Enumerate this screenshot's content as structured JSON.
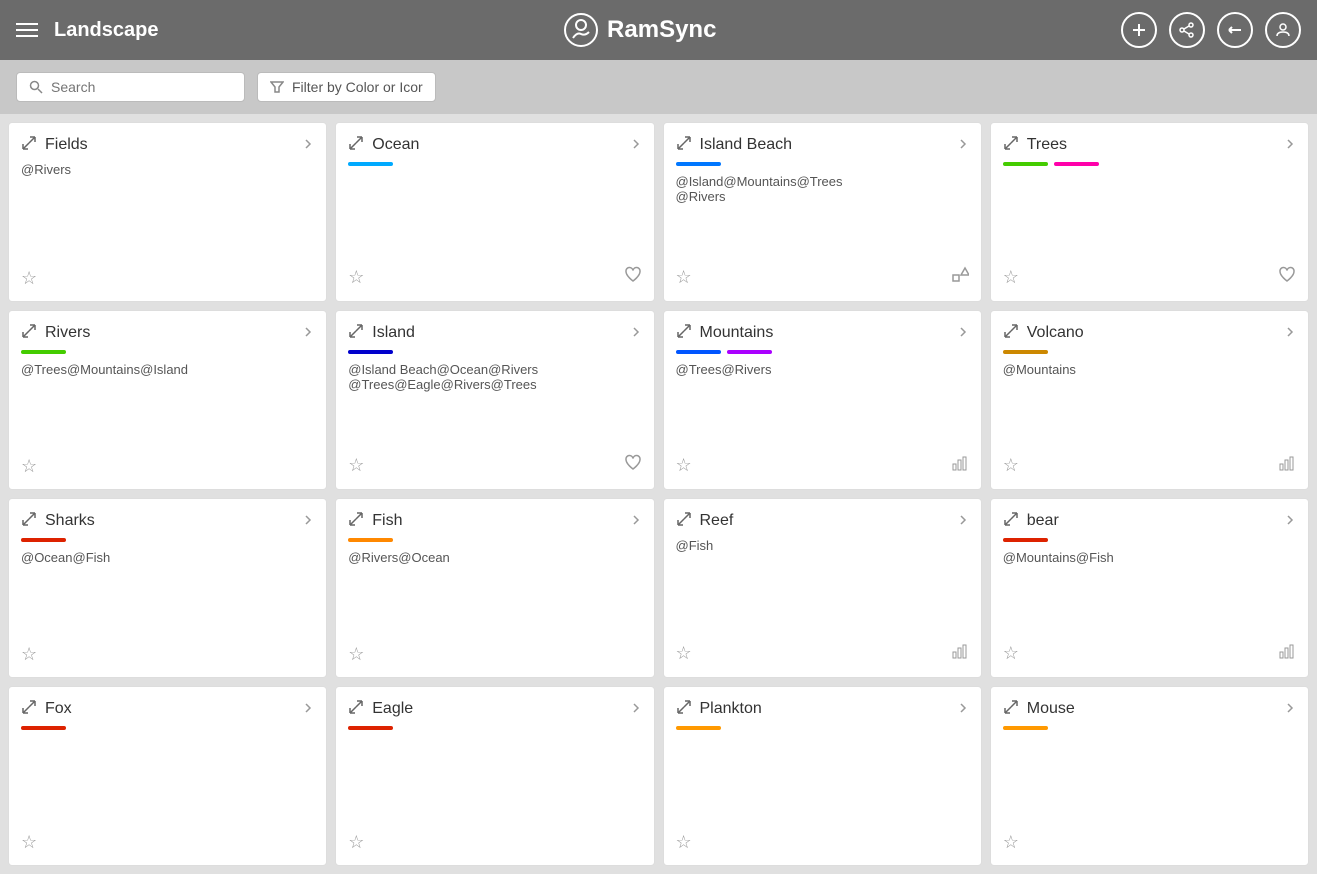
{
  "header": {
    "title": "Landscape",
    "logo_text": "RamSync",
    "icons": [
      "plus-icon",
      "share-icon",
      "sync-icon",
      "user-icon"
    ]
  },
  "toolbar": {
    "search_placeholder": "Search",
    "filter_label": "Filter by Color or Icor"
  },
  "cards": [
    {
      "id": "fields",
      "title": "Fields",
      "colors": [],
      "tags": "@Rivers",
      "star": false,
      "bottom_right": ""
    },
    {
      "id": "ocean",
      "title": "Ocean",
      "colors": [
        "#00aaff"
      ],
      "tags": "",
      "star": false,
      "bottom_right": "heart"
    },
    {
      "id": "island-beach",
      "title": "Island Beach",
      "colors": [
        "#0077ff"
      ],
      "tags": "@Island@Mountains@Trees\n@Rivers",
      "star": false,
      "bottom_right": "shape"
    },
    {
      "id": "trees",
      "title": "Trees",
      "colors": [
        "#44cc00",
        "#ff00aa"
      ],
      "tags": "",
      "star": false,
      "bottom_right": "heart"
    },
    {
      "id": "rivers",
      "title": "Rivers",
      "colors": [
        "#44cc00"
      ],
      "tags": "@Trees@Mountains@Island",
      "star": false,
      "bottom_right": ""
    },
    {
      "id": "island",
      "title": "Island",
      "colors": [
        "#0000cc"
      ],
      "tags": "@Island Beach@Ocean@Rivers\n@Trees@Eagle@Rivers@Trees",
      "star": false,
      "bottom_right": "heart"
    },
    {
      "id": "mountains",
      "title": "Mountains",
      "colors": [
        "#0055ff",
        "#aa00ff"
      ],
      "tags": "@Trees@Rivers",
      "star": false,
      "bottom_right": "chart"
    },
    {
      "id": "volcano",
      "title": "Volcano",
      "colors": [
        "#cc8800"
      ],
      "tags": "@Mountains",
      "star": false,
      "bottom_right": "chart"
    },
    {
      "id": "sharks",
      "title": "Sharks",
      "colors": [
        "#dd2200"
      ],
      "tags": "@Ocean@Fish",
      "star": false,
      "bottom_right": ""
    },
    {
      "id": "fish",
      "title": "Fish",
      "colors": [
        "#ff8800"
      ],
      "tags": "@Rivers@Ocean",
      "star": false,
      "bottom_right": ""
    },
    {
      "id": "reef",
      "title": "Reef",
      "colors": [],
      "tags": "@Fish",
      "star": false,
      "bottom_right": "chart"
    },
    {
      "id": "bear",
      "title": "bear",
      "colors": [
        "#dd2200"
      ],
      "tags": "@Mountains@Fish",
      "star": false,
      "bottom_right": "chart"
    },
    {
      "id": "fox",
      "title": "Fox",
      "colors": [
        "#dd2200"
      ],
      "tags": "",
      "star": false,
      "bottom_right": ""
    },
    {
      "id": "eagle",
      "title": "Eagle",
      "colors": [
        "#dd2200"
      ],
      "tags": "",
      "star": false,
      "bottom_right": ""
    },
    {
      "id": "plankton",
      "title": "Plankton",
      "colors": [
        "#ff9900"
      ],
      "tags": "",
      "star": false,
      "bottom_right": ""
    },
    {
      "id": "mouse",
      "title": "Mouse",
      "colors": [
        "#ff9900"
      ],
      "tags": "",
      "star": false,
      "bottom_right": ""
    }
  ]
}
